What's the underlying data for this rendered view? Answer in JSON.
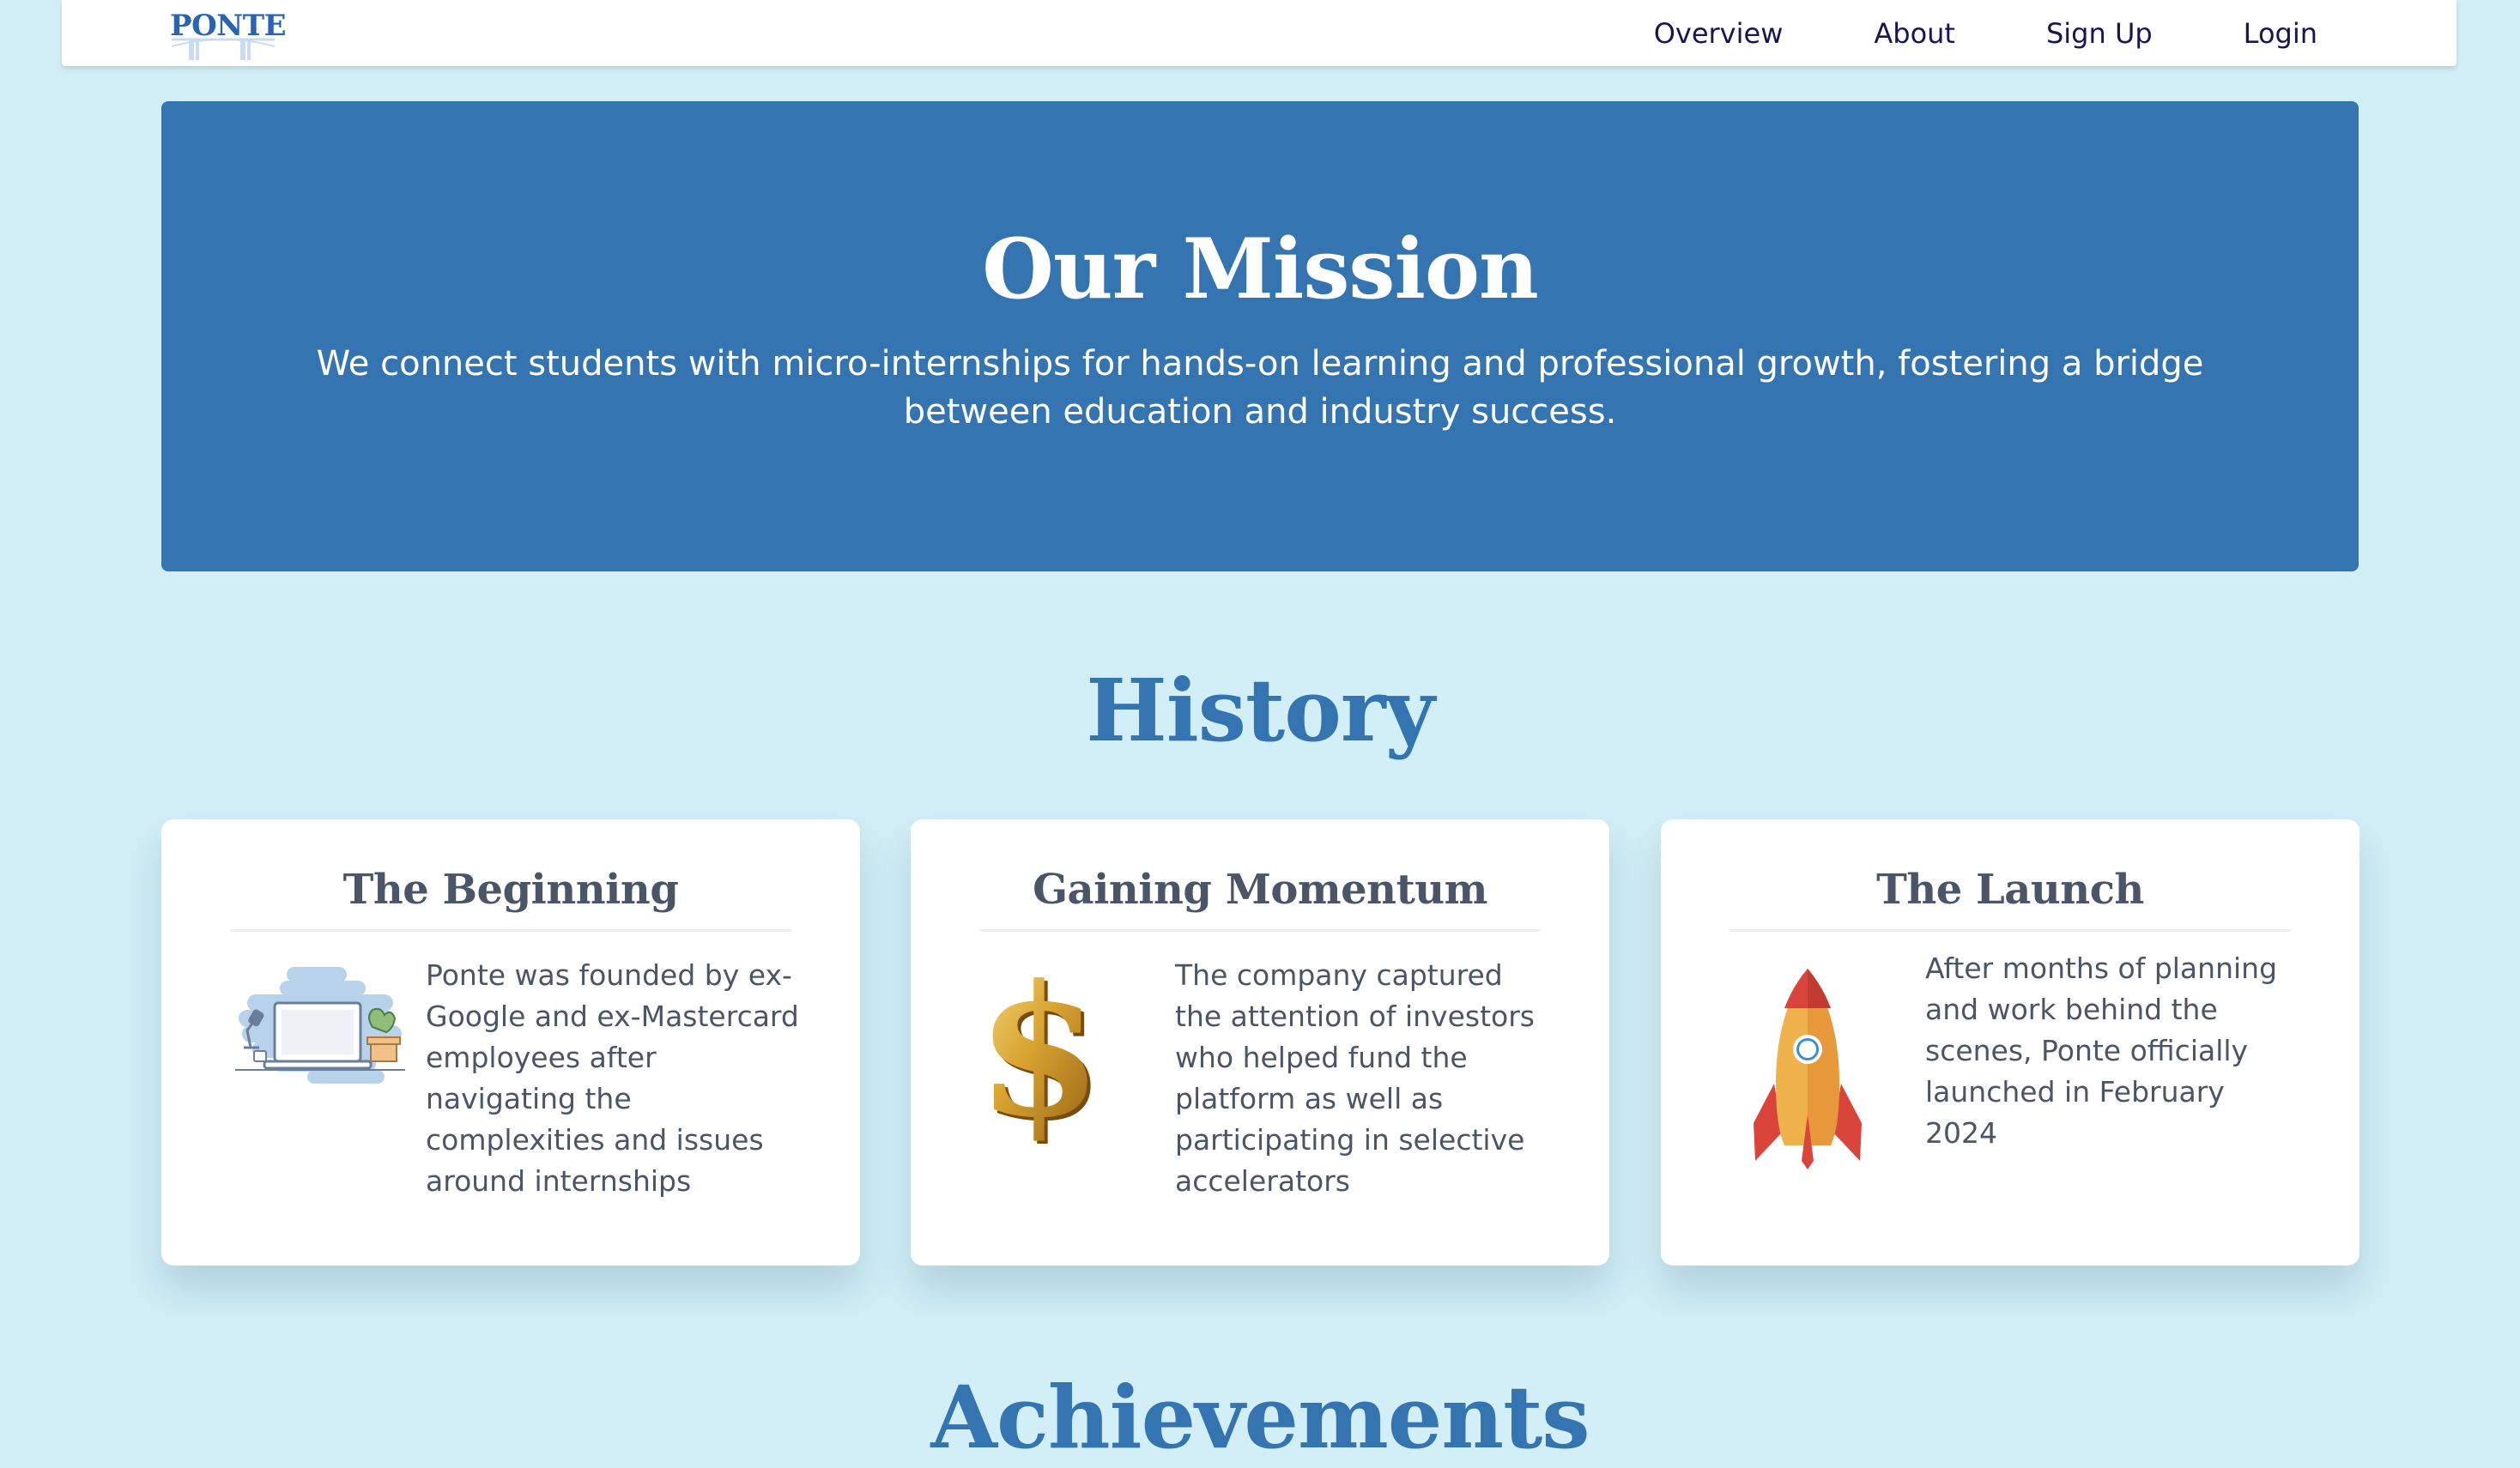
{
  "nav": {
    "logo_text": "PONTE",
    "links": [
      {
        "label": "Overview"
      },
      {
        "label": "About"
      },
      {
        "label": "Sign Up"
      },
      {
        "label": "Login"
      }
    ]
  },
  "mission": {
    "title": "Our Mission",
    "text": "We connect students with micro-internships for hands-on learning and professional growth, fostering a bridge between education and industry success."
  },
  "history": {
    "title": "History",
    "cards": [
      {
        "title": "The Beginning",
        "icon": "laptop-desk-icon",
        "text": "Ponte was founded by ex-Google and ex-Mastercard employees after navigating the complexities and issues around internships"
      },
      {
        "title": "Gaining Momentum",
        "icon": "dollar-sign-icon",
        "text": "The company captured the attention of investors who helped fund the platform as well as participating in selective accelerators"
      },
      {
        "title": "The Launch",
        "icon": "rocket-icon",
        "text": "After months of planning and work behind the scenes, Ponte officially launched in February 2024"
      }
    ]
  },
  "achievements": {
    "title": "Achievements"
  },
  "colors": {
    "page_background": "#d2eef6",
    "mission_background": "#3374b1",
    "heading_blue": "#3374b1",
    "nav_text": "#161650",
    "card_text": "#4a5568"
  }
}
